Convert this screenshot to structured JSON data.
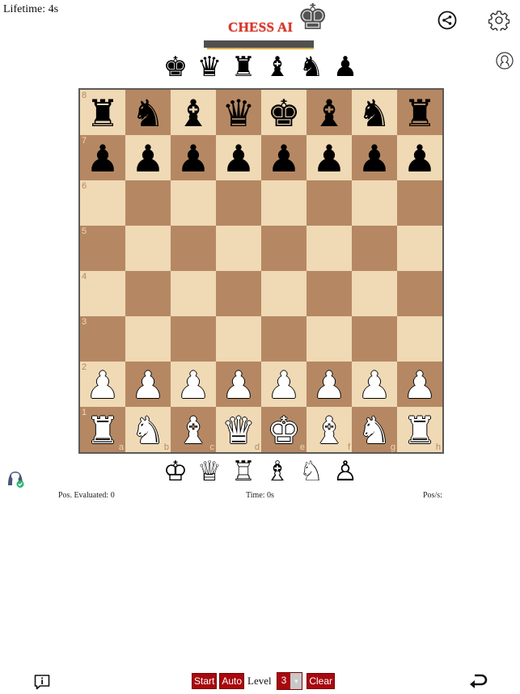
{
  "header": {
    "lifetime": "Lifetime: 4s",
    "logo_title": "CHESS AI",
    "logo_icon": "king-silhouette-icon"
  },
  "toolbar": {
    "share_icon": "share-icon",
    "settings_icon": "gear-icon",
    "account_icon": "user-icon"
  },
  "captured_top": [
    "♚",
    "♛",
    "♜",
    "♝",
    "♞",
    "♟"
  ],
  "captured_bottom": [
    "♔",
    "♕",
    "♖",
    "♗",
    "♘",
    "♙"
  ],
  "board": {
    "colors": {
      "light": "#f0d9b5",
      "dark": "#b58863"
    },
    "rank_labels": [
      "8",
      "7",
      "6",
      "5",
      "4",
      "3",
      "2",
      "1"
    ],
    "file_labels": [
      "a",
      "b",
      "c",
      "d",
      "e",
      "f",
      "g",
      "h"
    ],
    "position": [
      [
        "br",
        "bn",
        "bb",
        "bq",
        "bk",
        "bb",
        "bn",
        "br"
      ],
      [
        "bp",
        "bp",
        "bp",
        "bp",
        "bp",
        "bp",
        "bp",
        "bp"
      ],
      [
        "",
        "",
        "",
        "",
        "",
        "",
        "",
        ""
      ],
      [
        "",
        "",
        "",
        "",
        "",
        "",
        "",
        ""
      ],
      [
        "",
        "",
        "",
        "",
        "",
        "",
        "",
        ""
      ],
      [
        "",
        "",
        "",
        "",
        "",
        "",
        "",
        ""
      ],
      [
        "wp",
        "wp",
        "wp",
        "wp",
        "wp",
        "wp",
        "wp",
        "wp"
      ],
      [
        "wr",
        "wn",
        "wb",
        "wq",
        "wk",
        "wb",
        "wn",
        "wr"
      ]
    ],
    "glyphs": {
      "k": "♚",
      "q": "♛",
      "r": "♜",
      "b": "♝",
      "n": "♞",
      "p": "♟"
    }
  },
  "stats": {
    "positions_evaluated": "Pos. Evaluated: 0",
    "time": "Time: 0s",
    "positions_per_second": "Pos/s:"
  },
  "controls": {
    "start_label": "Start",
    "auto_label": "Auto",
    "level_label": "Level",
    "level_value": "3",
    "clear_label": "Clear",
    "accent": "#a8090e"
  },
  "footer": {
    "info_icon": "info-speech-icon",
    "undo_icon": "undo-arrow-icon"
  }
}
